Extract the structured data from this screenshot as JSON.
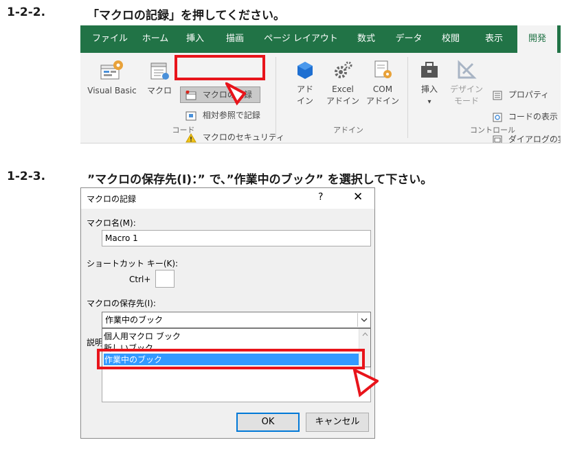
{
  "step1": {
    "number": "1-2-2.",
    "text": "「マクロの記録」を押してください。"
  },
  "ribbon": {
    "tabs": [
      "ファイル",
      "ホーム",
      "挿入",
      "描画",
      "ページ レイアウト",
      "数式",
      "データ",
      "校閲",
      "表示",
      "開発"
    ],
    "active_tab": "開発",
    "code_group": {
      "label": "コード",
      "visual_basic": "Visual Basic",
      "macro": "マクロ",
      "record_macro": "マクロの記録",
      "relative_ref": "相対参照で記録",
      "macro_security": "マクロのセキュリティ"
    },
    "addins_group": {
      "label": "アドイン",
      "addins_line1": "アド",
      "addins_line2": "イン",
      "excel_addins_line1": "Excel",
      "excel_addins_line2": "アドイン",
      "com_addins_line1": "COM",
      "com_addins_line2": "アドイン"
    },
    "controls_group": {
      "label": "コントロール",
      "insert": "挿入",
      "insert_arrow": "▾",
      "design_mode_line1": "デザイン",
      "design_mode_line2": "モード",
      "properties": "プロパティ",
      "view_code": "コードの表示",
      "run_dialog": "ダイアログの実行"
    }
  },
  "step2": {
    "number": "1-2-3.",
    "text": "”マクロの保存先(I)：” で、”作業中のブック” を選択して下さい。"
  },
  "dialog": {
    "title": "マクロの記録",
    "help": "?",
    "close": "✕",
    "macro_name_label": "マクロ名(M):",
    "macro_name_value": "Macro 1",
    "shortcut_label": "ショートカット キー(K):",
    "ctrl_label": "Ctrl+",
    "shortcut_value": "",
    "store_label": "マクロの保存先(I):",
    "store_value": "作業中のブック",
    "options": [
      "個人用マクロ ブック",
      "新しいブック",
      "作業中のブック"
    ],
    "selected_index": 2,
    "description_label": "説明",
    "ok": "OK",
    "cancel": "キャンセル"
  },
  "colors": {
    "excel_green": "#217346",
    "callout_red": "#e8141b",
    "selection_blue": "#3399ff"
  }
}
